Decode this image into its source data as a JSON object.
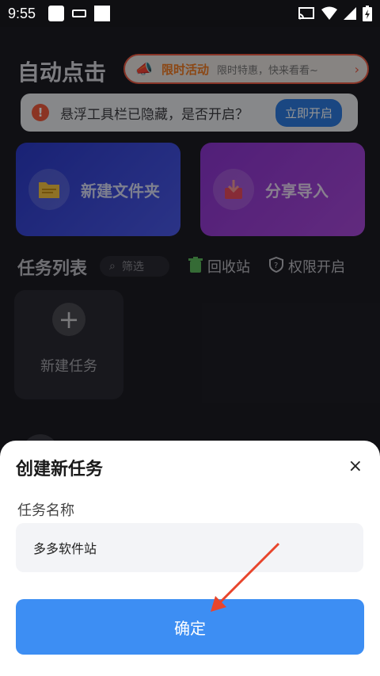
{
  "status_bar": {
    "time": "9:55"
  },
  "app": {
    "title": "自动点击",
    "promo": {
      "hot_label": "限时活动",
      "sub_label": "限时特惠，快来看看~"
    },
    "notice": {
      "text": "悬浮工具栏已隐藏，是否开启？",
      "button": "立即开启"
    },
    "cards": {
      "folder": "新建文件夹",
      "share": "分享导入"
    },
    "tasks": {
      "heading": "任务列表",
      "filter": "筛选",
      "recycle": "回收站",
      "permission": "权限开启",
      "new_task": "新建任务"
    }
  },
  "sheet": {
    "title": "创建新任务",
    "close": "×",
    "field_label": "任务名称",
    "field_value": "多多软件站",
    "confirm": "确定"
  },
  "colors": {
    "accent": "#3d8ef3",
    "arrow": "#e8452c"
  }
}
